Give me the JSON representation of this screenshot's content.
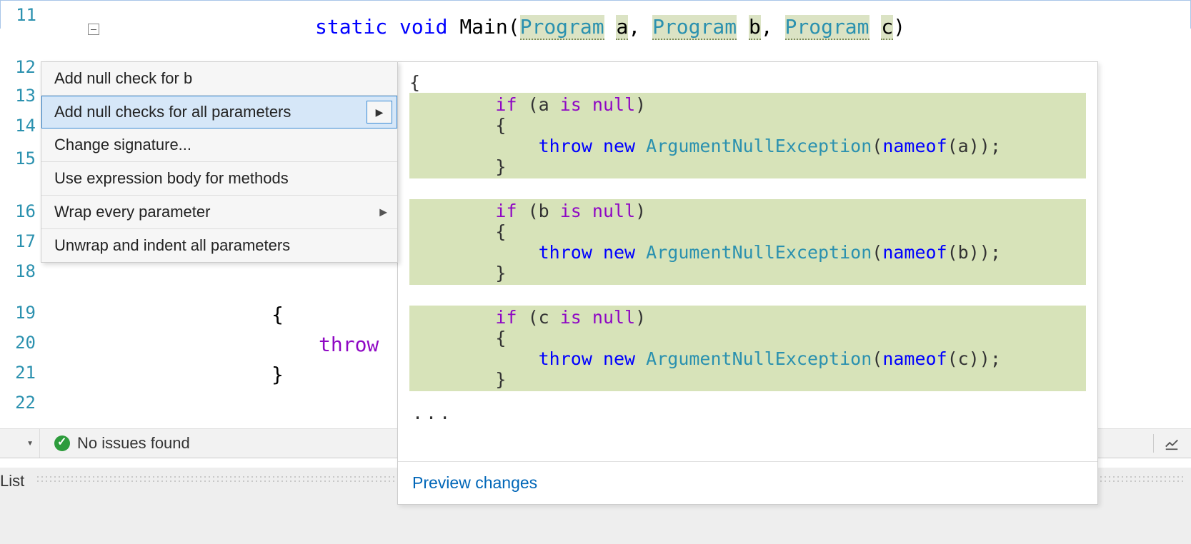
{
  "editor": {
    "line_numbers": [
      11,
      12,
      13,
      14,
      15,
      16,
      17,
      18,
      19,
      20,
      21,
      22
    ],
    "signature": {
      "kw_static": "static",
      "kw_void": "void",
      "method": "Main",
      "p_type": "Program",
      "p1": "a",
      "p2": "b",
      "p3": "c"
    },
    "bg": {
      "brace_open": "{",
      "throw_kw": "throw",
      "brace_close": "}"
    }
  },
  "menu": {
    "items": [
      "Add null check for b",
      "Add null checks for all parameters",
      "Change signature...",
      "Use expression body for methods",
      "Wrap every parameter",
      "Unwrap and indent all parameters"
    ]
  },
  "preview": {
    "brace": "{",
    "block_a": "        if (a is null)\n        {\n            throw new ArgumentNullException(nameof(a));\n        }\n",
    "block_b": "        if (b is null)\n        {\n            throw new ArgumentNullException(nameof(b));\n        }\n",
    "block_c": "        if (c is null)\n        {\n            throw new ArgumentNullException(nameof(c));\n        }",
    "ellipsis": "...",
    "footer": "Preview changes"
  },
  "status": {
    "text": "No issues found"
  },
  "bottom": {
    "label": "List"
  }
}
